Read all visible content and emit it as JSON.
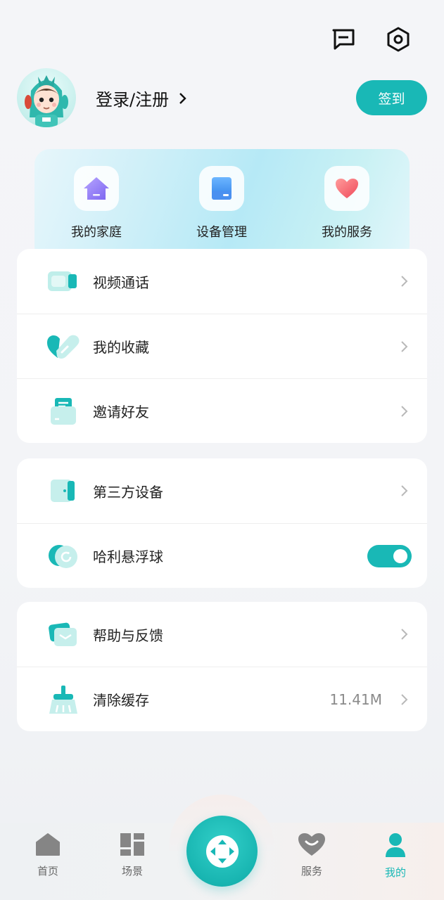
{
  "header": {
    "icons": [
      "message-icon",
      "settings-icon"
    ],
    "login_label": "登录/注册",
    "checkin_label": "签到"
  },
  "quick": [
    {
      "label": "我的家庭",
      "icon": "home-icon"
    },
    {
      "label": "设备管理",
      "icon": "device-icon"
    },
    {
      "label": "我的服务",
      "icon": "heart-icon"
    }
  ],
  "group1": [
    {
      "label": "视频通话",
      "icon": "video-call-icon"
    },
    {
      "label": "我的收藏",
      "icon": "favorite-icon"
    },
    {
      "label": "邀请好友",
      "icon": "invite-icon"
    }
  ],
  "group2": [
    {
      "label": "第三方设备",
      "icon": "third-party-device-icon"
    },
    {
      "label": "哈利悬浮球",
      "icon": "floating-ball-icon",
      "toggle": true
    }
  ],
  "group3": [
    {
      "label": "帮助与反馈",
      "icon": "help-feedback-icon"
    },
    {
      "label": "清除缓存",
      "icon": "broom-icon",
      "value": "11.41M"
    }
  ],
  "tabbar": {
    "tabs": [
      {
        "label": "首页",
        "icon": "home-tab-icon"
      },
      {
        "label": "场景",
        "icon": "scene-tab-icon"
      },
      {
        "label": "服务",
        "icon": "service-tab-icon"
      },
      {
        "label": "我的",
        "icon": "profile-tab-icon",
        "active": true
      }
    ],
    "center_icon": "control-pad-icon"
  },
  "colors": {
    "accent": "#19b8b6"
  }
}
